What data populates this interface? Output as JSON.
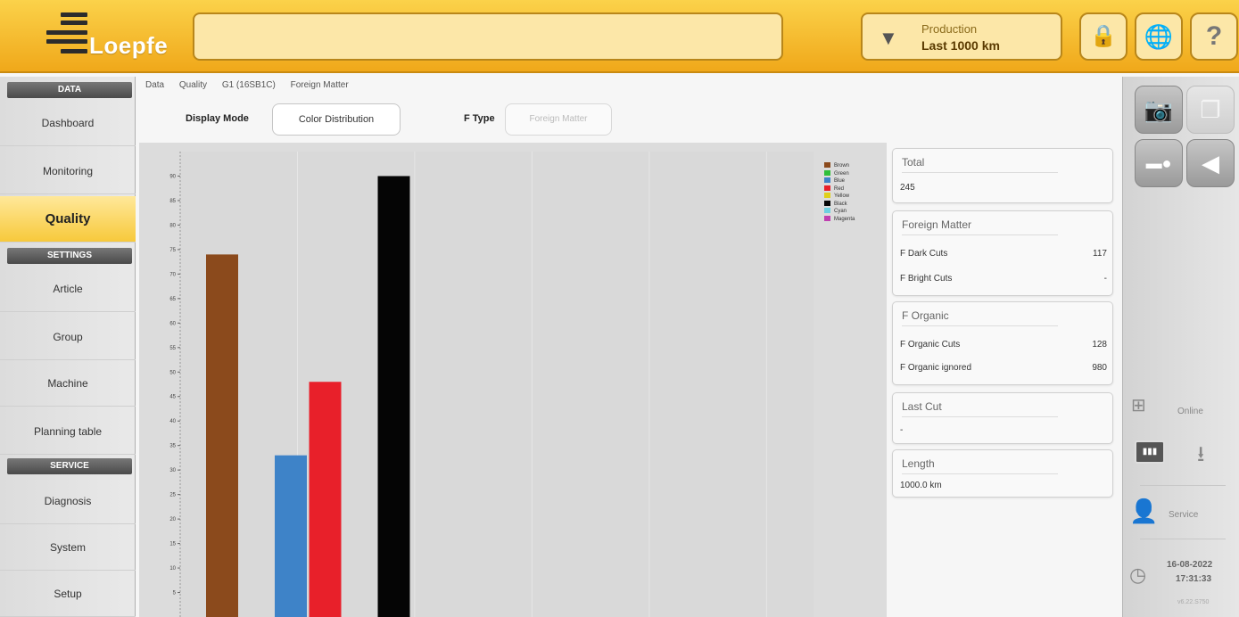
{
  "header": {
    "logo_text": "Loepfe",
    "search_value": "",
    "production": {
      "line1": "Production",
      "line2": "Last 1000 km"
    },
    "buttons": {
      "lock": "🔒",
      "globe": "🌐",
      "help": "?"
    }
  },
  "sidebar": {
    "sections": [
      {
        "header": "DATA",
        "items": [
          "Dashboard",
          "Monitoring",
          "Quality"
        ]
      },
      {
        "header": "SETTINGS",
        "items": [
          "Article",
          "Group",
          "Machine",
          "Planning table"
        ]
      },
      {
        "header": "SERVICE",
        "items": [
          "Diagnosis",
          "System",
          "Setup"
        ]
      }
    ],
    "active": "Quality"
  },
  "breadcrumb": [
    "Data",
    "Quality",
    "G1 (16SB1C)",
    "Foreign Matter"
  ],
  "toolbar": {
    "display_mode_label": "Display Mode",
    "display_mode_value": "Color Distribution",
    "ftype_label": "F Type",
    "ftype_value": "Foreign Matter"
  },
  "chart_data": {
    "type": "bar",
    "categories": [
      "Brown",
      "Green",
      "Blue",
      "Red",
      "Yellow",
      "Black",
      "Cyan",
      "Magenta"
    ],
    "values": [
      74,
      0,
      33,
      48,
      0,
      90,
      0,
      0
    ],
    "colors": [
      "#8b4a1c",
      "#2fbf3a",
      "#3e83c8",
      "#e8202a",
      "#e0d01a",
      "#050505",
      "#6ed0e0",
      "#c040b0"
    ],
    "ylim": [
      0,
      95
    ],
    "yticks": [
      5,
      10,
      15,
      20,
      25,
      30,
      35,
      40,
      45,
      50,
      55,
      60,
      65,
      70,
      75,
      80,
      85,
      90
    ],
    "legend": [
      "Brown",
      "Green",
      "Blue",
      "Red",
      "Yellow",
      "Black",
      "Cyan",
      "Magenta"
    ],
    "legend_position": "top-right",
    "grid": true
  },
  "panels": {
    "total": {
      "title": "Total",
      "value": "245"
    },
    "foreign_matter": {
      "title": "Foreign Matter",
      "rows": [
        {
          "label": "F Dark Cuts",
          "value": "117"
        },
        {
          "label": "F Bright Cuts",
          "value": "-"
        }
      ]
    },
    "f_organic": {
      "title": "F Organic",
      "rows": [
        {
          "label": "F Organic Cuts",
          "value": "128"
        },
        {
          "label": "F Organic ignored",
          "value": "980"
        }
      ]
    },
    "last_cut": {
      "title": "Last Cut",
      "value": "-"
    },
    "length": {
      "title": "Length",
      "value": "1000.0 km"
    }
  },
  "rail": {
    "online_label": "Online",
    "user_label": "Service",
    "date": "16-08-2022",
    "time": "17:31:33",
    "version": "v6.22.S750",
    "icons": {
      "camera": "camera-icon",
      "copy": "copy-icon",
      "record": "record-icon",
      "back": "back-arrow-icon"
    }
  },
  "colors": {
    "brand": "#f5b82b",
    "active_nav": "#fad455"
  }
}
